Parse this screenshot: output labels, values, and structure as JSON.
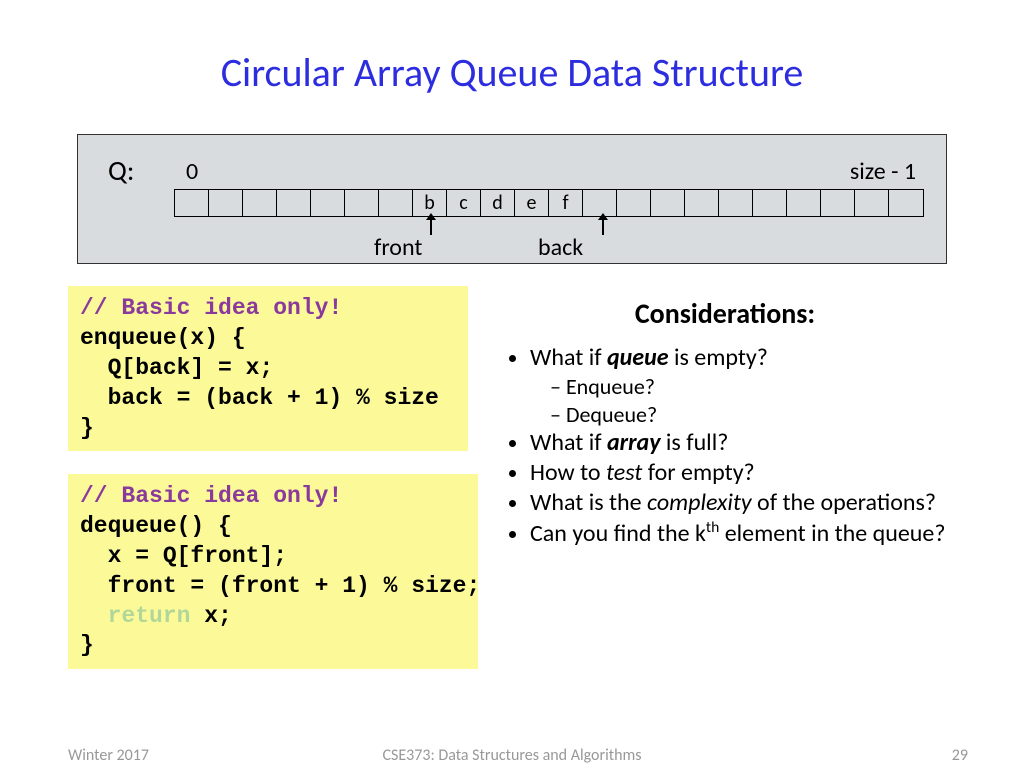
{
  "title": "Circular Array Queue Data Structure",
  "queue": {
    "label": "Q:",
    "zero": "0",
    "size": "size - 1",
    "cells": [
      "",
      "",
      "",
      "",
      "",
      "",
      "",
      "b",
      "c",
      "d",
      "e",
      "f",
      "",
      "",
      "",
      "",
      "",
      "",
      "",
      "",
      "",
      ""
    ],
    "front_label": "front",
    "back_label": "back"
  },
  "code1": {
    "comment": "// Basic idea only!",
    "l1": "enqueue(x) {",
    "l2": "  Q[back] = x;",
    "l3": "  back = (back + 1) % size",
    "l4": "}"
  },
  "code2": {
    "comment": "// Basic idea only!",
    "l1": "dequeue() {",
    "l2": "  x = Q[front];",
    "l3": "  front = (front + 1) % size;",
    "kw": "  return",
    "rest": " x;",
    "l5": "}"
  },
  "considerations": {
    "heading": "Considerations:",
    "i1a": "What if ",
    "i1b": "queue",
    "i1c": " is empty?",
    "s1": "Enqueue?",
    "s2": "Dequeue?",
    "i2a": "What if ",
    "i2b": "array",
    "i2c": " is full?",
    "i3a": "How to ",
    "i3b": "test",
    "i3c": " for empty?",
    "i4a": "What is the ",
    "i4b": "complexity",
    "i4c": " of the operations?",
    "i5a": "Can you find the k",
    "i5sup": "th",
    "i5b": " element in the queue?"
  },
  "footer": {
    "left": "Winter 2017",
    "center": "CSE373: Data Structures and Algorithms",
    "right": "29"
  }
}
